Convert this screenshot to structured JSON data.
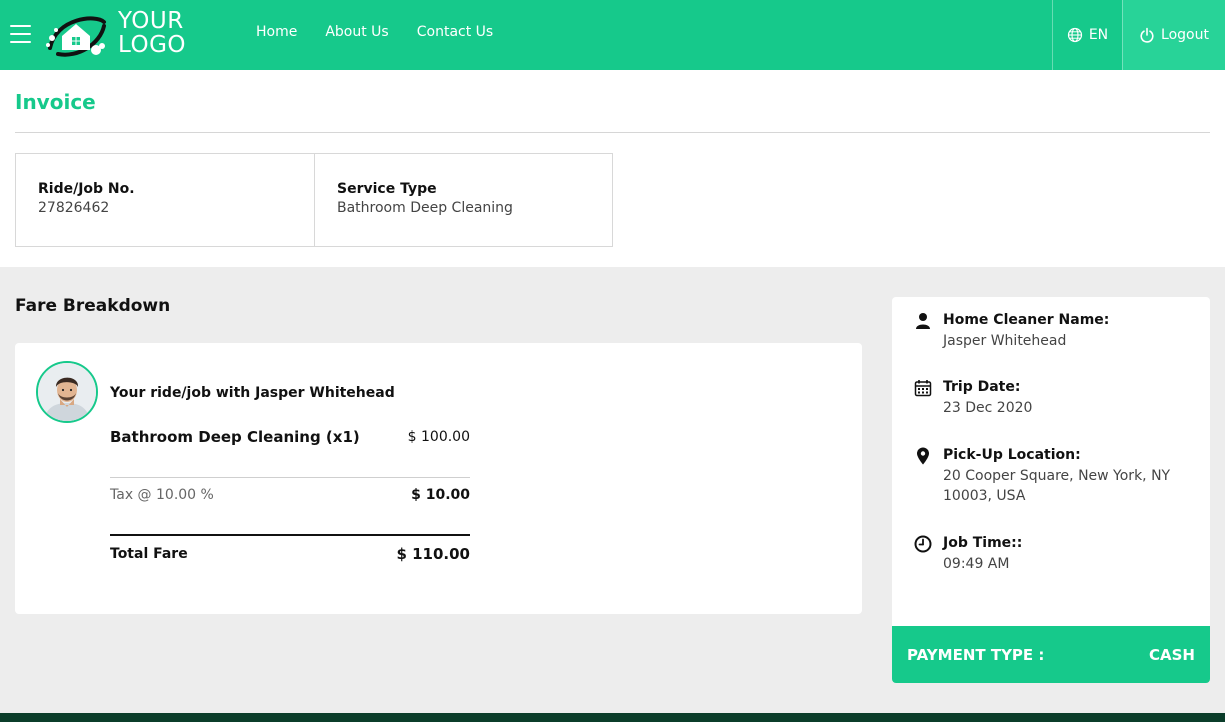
{
  "header": {
    "logo_line1": "YOUR",
    "logo_line2": "LOGO",
    "nav": [
      "Home",
      "About Us",
      "Contact Us"
    ],
    "language": "EN",
    "logout": "Logout",
    "brand_color": "#16c98b"
  },
  "invoice": {
    "title": "Invoice",
    "ride_job_label": "Ride/Job No.",
    "ride_job_value": "27826462",
    "service_type_label": "Service Type",
    "service_type_value": "Bathroom Deep Cleaning"
  },
  "fare": {
    "title": "Fare Breakdown",
    "ride_with": "Your ride/job with Jasper Whitehead",
    "item_label": "Bathroom Deep Cleaning (x1)",
    "item_amount": "$ 100.00",
    "tax_label": "Tax @ 10.00 %",
    "tax_amount": "$ 10.00",
    "total_label": "Total Fare",
    "total_amount": "$ 110.00"
  },
  "details": {
    "cleaner_label": "Home Cleaner Name:",
    "cleaner_value": "Jasper Whitehead",
    "date_label": "Trip Date:",
    "date_value": "23 Dec 2020",
    "location_label": "Pick-Up Location:",
    "location_value": "20 Cooper Square, New York, NY 10003, USA",
    "time_label": "Job Time::",
    "time_value": "09:49 AM",
    "payment_label": "PAYMENT TYPE :",
    "payment_value": "CASH"
  }
}
